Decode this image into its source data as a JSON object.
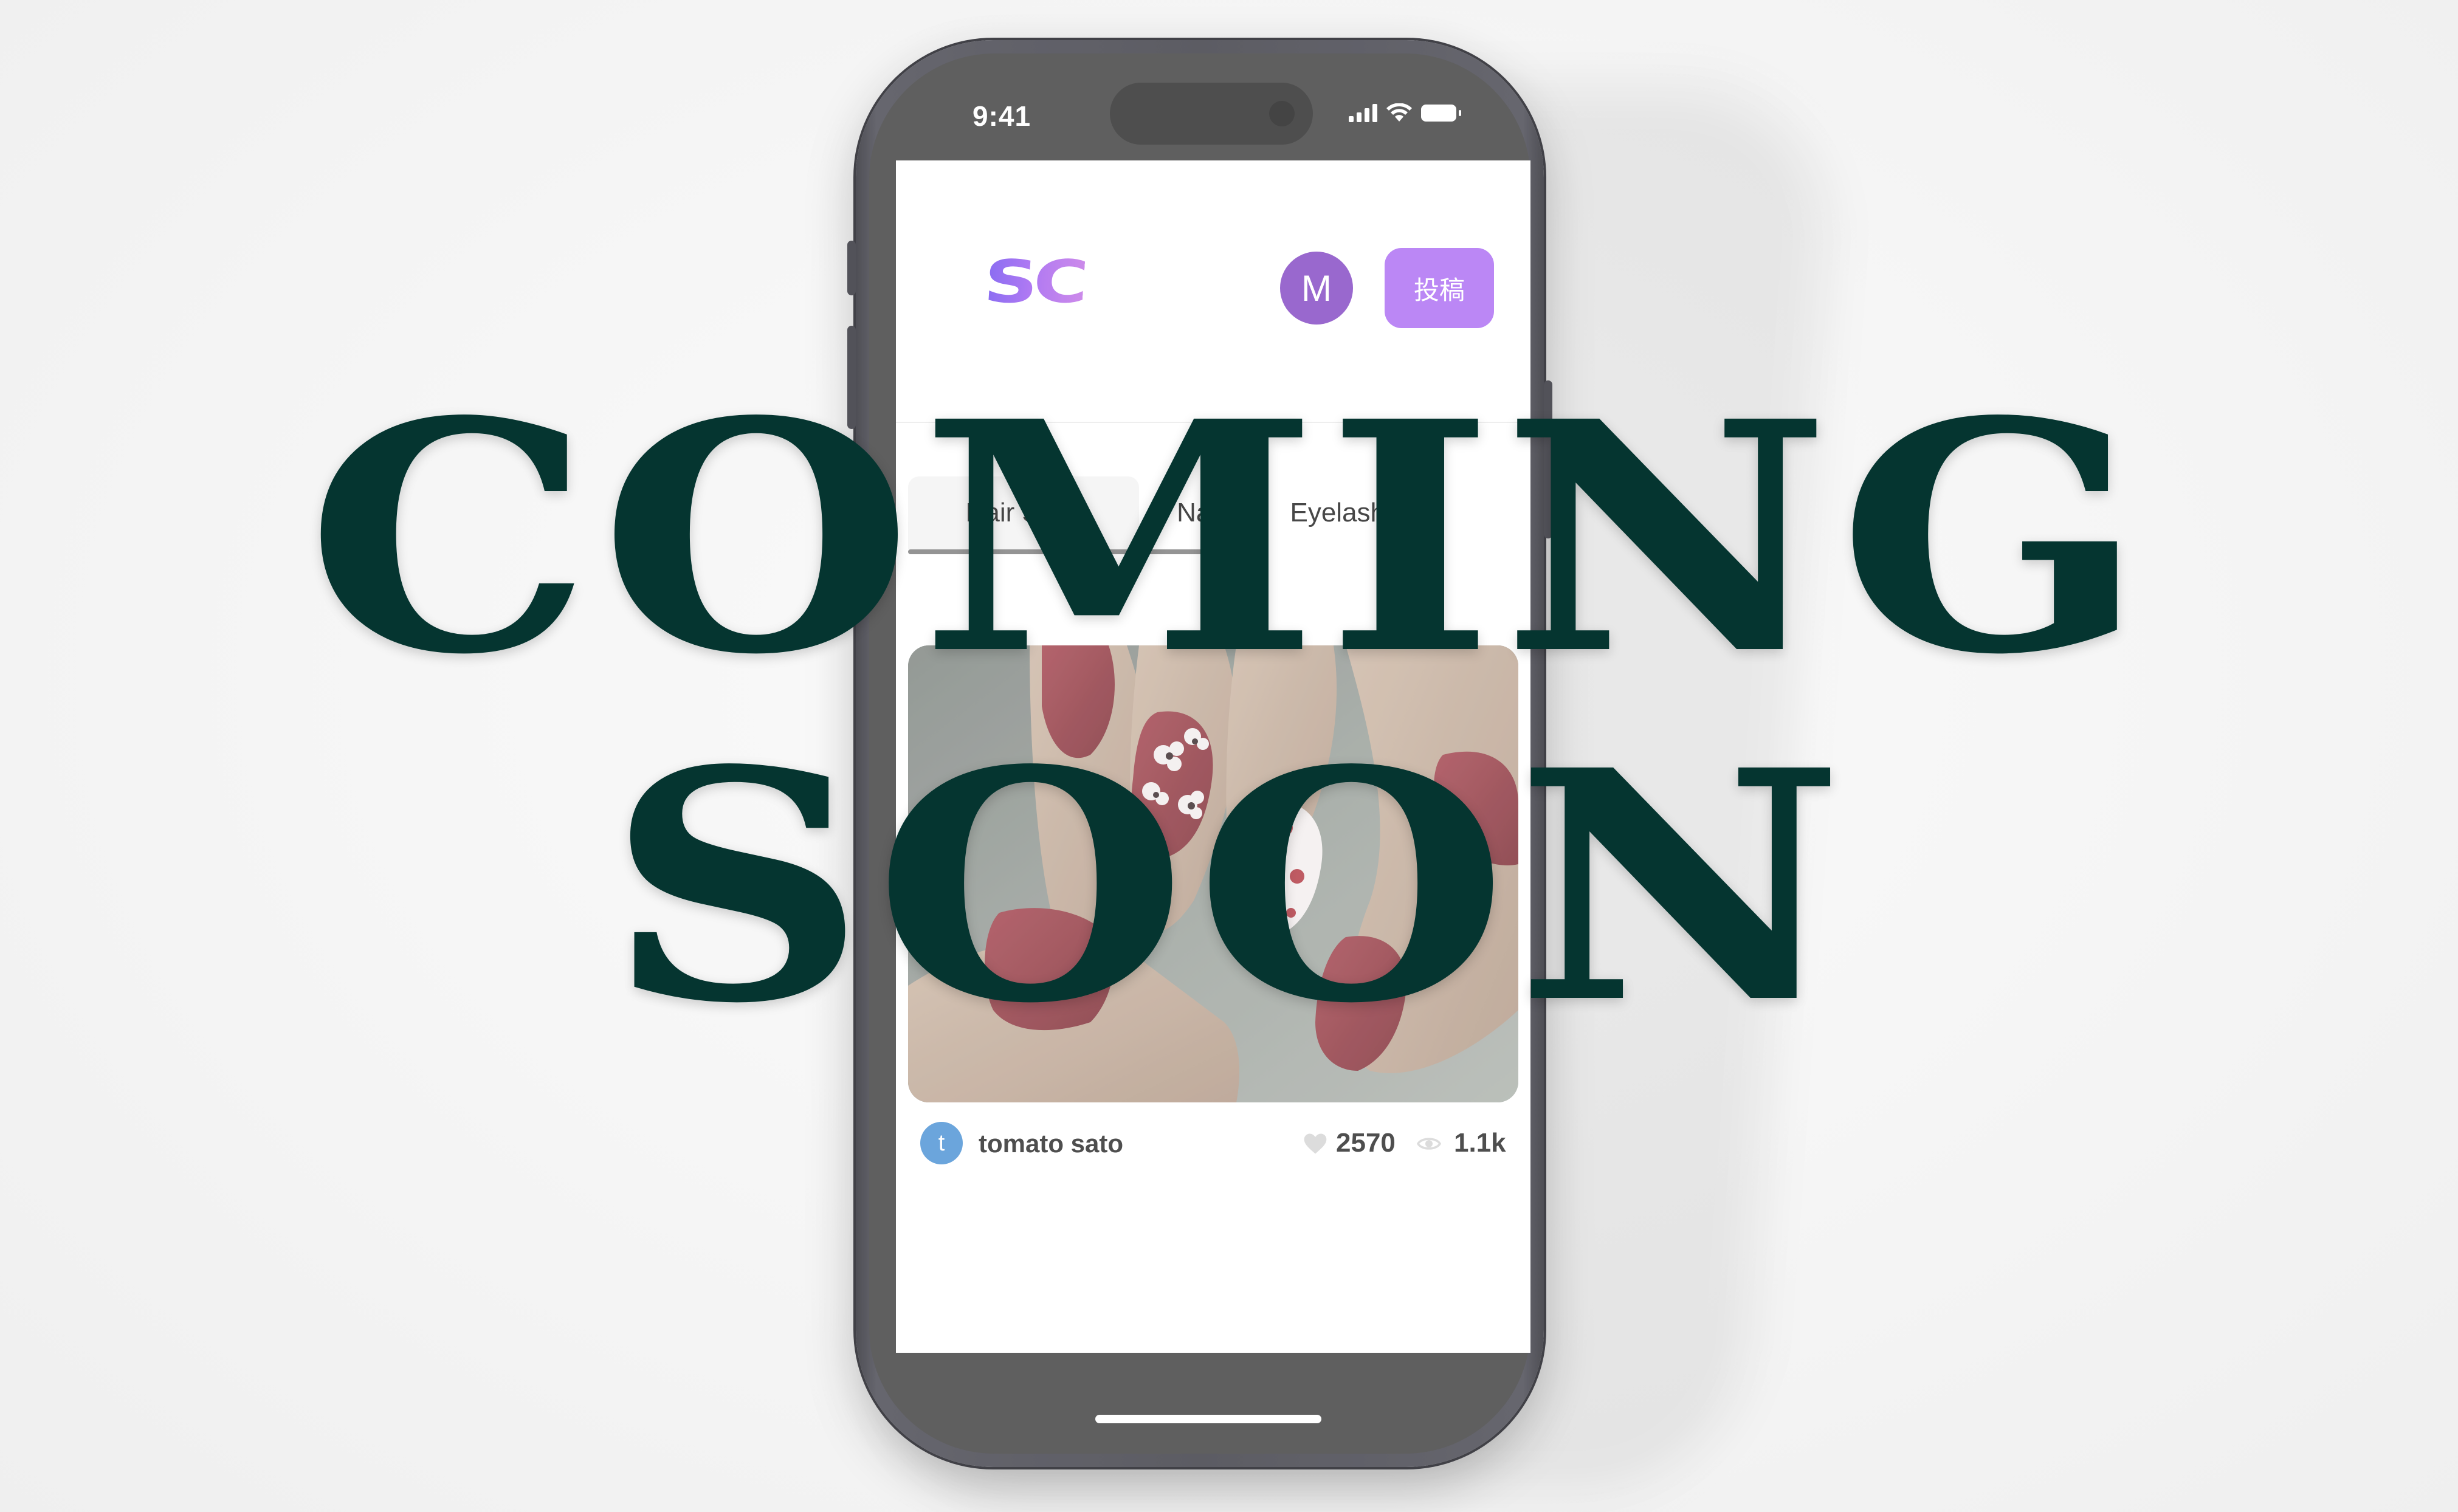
{
  "status_bar": {
    "time": "9:41"
  },
  "app": {
    "logo_text": "SC",
    "user_avatar_initial": "M",
    "post_button_label": "投稿",
    "colors": {
      "logo_gradient_start": "#7b5cf0",
      "logo_gradient_end": "#c77de8",
      "avatar": "#8e57c9",
      "post_button": "#b47af4",
      "author_avatar": "#5b9bd8"
    }
  },
  "tabs": [
    {
      "label": "Hair Style",
      "active": true
    },
    {
      "label": "Nail",
      "active": false
    },
    {
      "label": "Eyelashes",
      "active": false
    }
  ],
  "post": {
    "image_subject": "red nail art with white flower pattern",
    "author_initial": "t",
    "author_name": "tomato sato",
    "likes": "2570",
    "views": "1.1k",
    "icons": {
      "likes": "heart-icon",
      "views": "eye-icon"
    }
  },
  "overlay": {
    "line1": "COMING",
    "line2": "SOON",
    "color": "#053530"
  }
}
